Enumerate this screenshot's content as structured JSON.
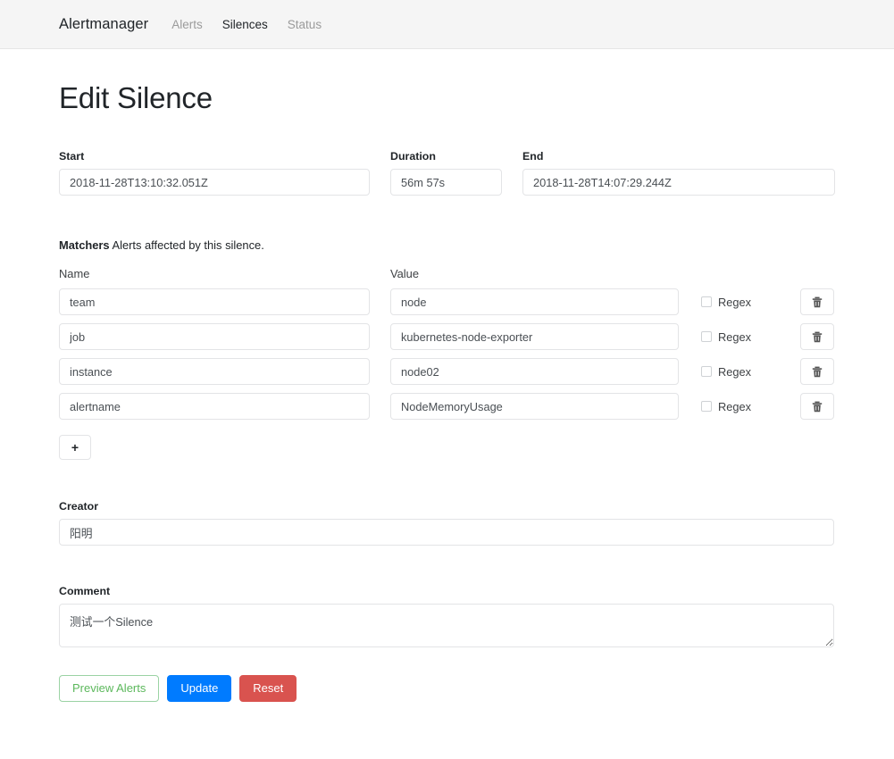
{
  "navbar": {
    "brand": "Alertmanager",
    "links": [
      {
        "label": "Alerts",
        "active": false
      },
      {
        "label": "Silences",
        "active": true
      },
      {
        "label": "Status",
        "active": false
      }
    ]
  },
  "page": {
    "title": "Edit Silence"
  },
  "times": {
    "start_label": "Start",
    "start_value": "2018-11-28T13:10:32.051Z",
    "duration_label": "Duration",
    "duration_value": "56m 57s",
    "end_label": "End",
    "end_value": "2018-11-28T14:07:29.244Z"
  },
  "matchers": {
    "heading": "Matchers",
    "description": "Alerts affected by this silence.",
    "col_name": "Name",
    "col_value": "Value",
    "regex_label": "Regex",
    "add_label": "+",
    "delete_icon": "trash-icon",
    "rows": [
      {
        "name": "team",
        "value": "node",
        "regex": false
      },
      {
        "name": "job",
        "value": "kubernetes-node-exporter",
        "regex": false
      },
      {
        "name": "instance",
        "value": "node02",
        "regex": false
      },
      {
        "name": "alertname",
        "value": "NodeMemoryUsage",
        "regex": false
      }
    ]
  },
  "creator": {
    "label": "Creator",
    "value": "阳明"
  },
  "comment": {
    "label": "Comment",
    "value": "测试一个Silence"
  },
  "actions": {
    "preview_label": "Preview Alerts",
    "update_label": "Update",
    "reset_label": "Reset"
  },
  "colors": {
    "primary": "#007bff",
    "danger": "#d9534f",
    "success": "#5cb85c",
    "navbar_bg": "#f5f5f5",
    "border": "#e3e4e6"
  }
}
